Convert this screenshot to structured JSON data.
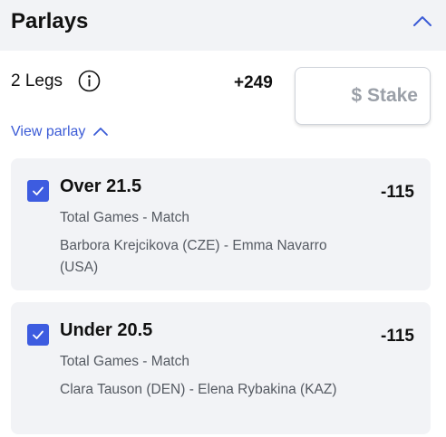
{
  "header": {
    "title": "Parlays"
  },
  "parlay": {
    "legs_label": "2 Legs",
    "total_odds": "+249",
    "stake_placeholder": "$ Stake",
    "view_parlay_label": "View parlay"
  },
  "legs": [
    {
      "selection": "Over 21.5",
      "odds": "-115",
      "market": "Total Games - Match",
      "match": "Barbora Krejcikova (CZE) - Emma Navarro (USA)",
      "checked": true
    },
    {
      "selection": "Under 20.5",
      "odds": "-115",
      "market": "Total Games - Match",
      "match": "Clara Tauson (DEN) - Elena Rybakina (KAZ)",
      "checked": true
    }
  ],
  "colors": {
    "accent": "#3d5ce0",
    "link": "#3b5bd6",
    "card_bg": "#f2f3f6"
  },
  "icons": {
    "collapse": "chevron-up-icon",
    "info": "info-icon",
    "expand_toggle": "chevron-up-icon",
    "leg_checkbox": "check-icon"
  }
}
